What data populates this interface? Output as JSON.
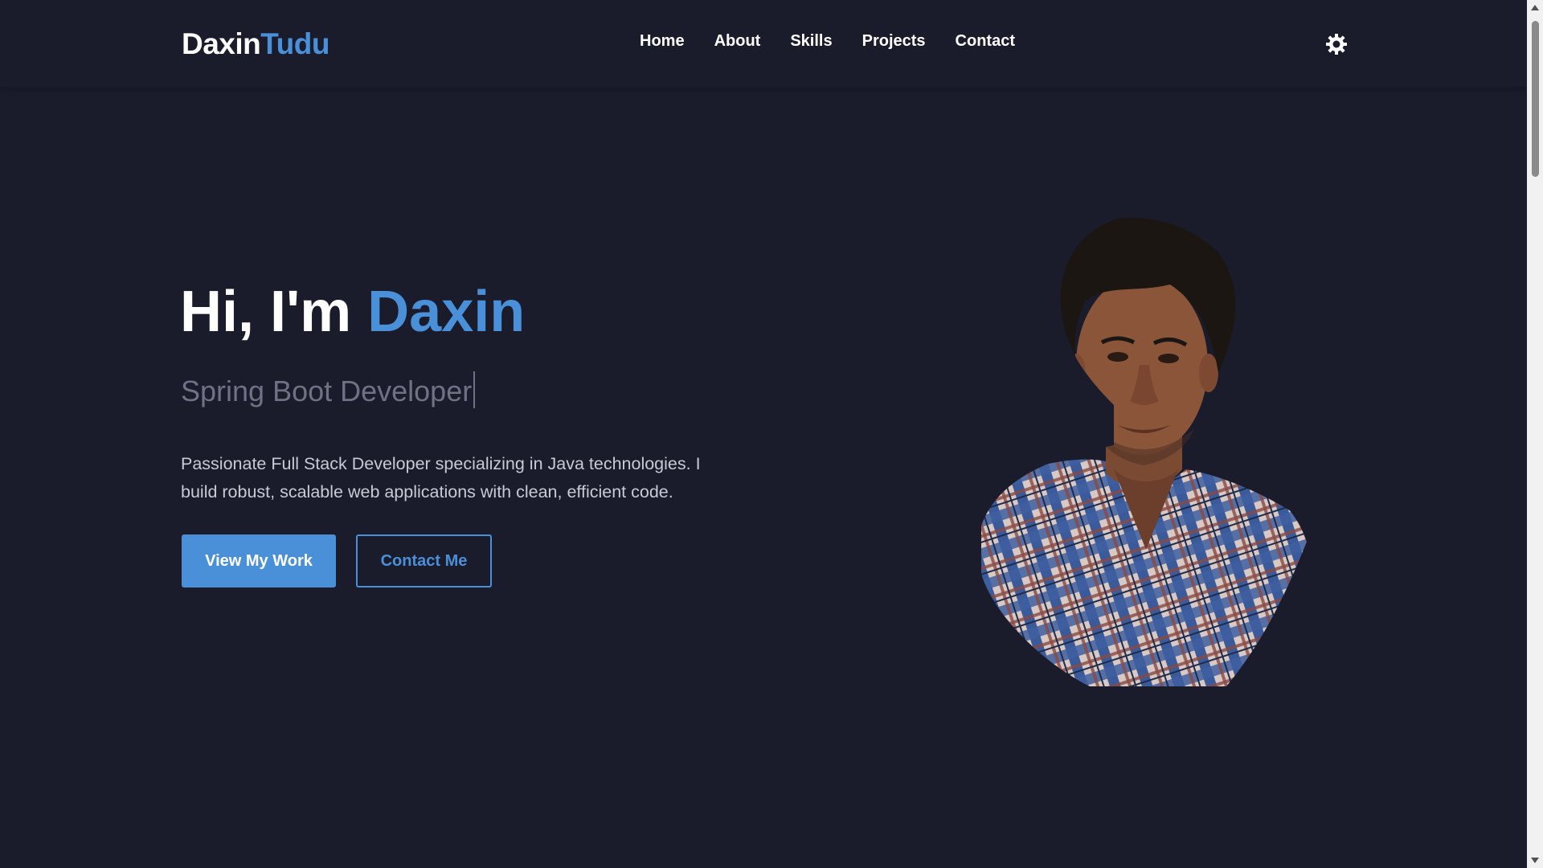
{
  "brand": {
    "logo_first": "Daxin",
    "logo_second": "Tudu",
    "accent_color": "#4a90d9",
    "background_color": "#1a1b2b"
  },
  "nav": {
    "items": [
      {
        "label": "Home"
      },
      {
        "label": "About"
      },
      {
        "label": "Skills"
      },
      {
        "label": "Projects"
      },
      {
        "label": "Contact"
      }
    ],
    "theme_toggle_icon": "sun-icon"
  },
  "hero": {
    "greeting": "Hi, I'm ",
    "name": "Daxin",
    "subtitle": "Spring Boot Developer",
    "description": "Passionate Full Stack Developer specializing in Java technologies. I build robust, scalable web applications with clean, efficient code.",
    "primary_button": "View My Work",
    "secondary_button": "Contact Me",
    "portrait_icon": "profile-photo"
  }
}
